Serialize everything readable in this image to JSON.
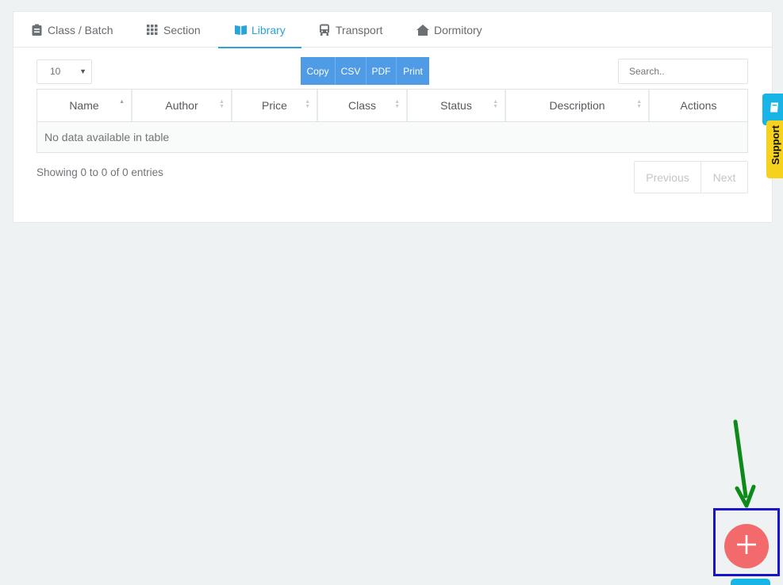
{
  "tabs": [
    {
      "label": "Class / Batch",
      "icon": "clipboard-icon",
      "active": false
    },
    {
      "label": "Section",
      "icon": "grid-icon",
      "active": false
    },
    {
      "label": "Library",
      "icon": "book-icon",
      "active": true
    },
    {
      "label": "Transport",
      "icon": "bus-icon",
      "active": false
    },
    {
      "label": "Dormitory",
      "icon": "home-icon",
      "active": false
    }
  ],
  "table_controls": {
    "page_length": "10",
    "export_buttons": [
      "Copy",
      "CSV",
      "PDF",
      "Print"
    ],
    "search_placeholder": "Search.."
  },
  "table": {
    "columns": [
      "Name",
      "Author",
      "Price",
      "Class",
      "Status",
      "Description",
      "Actions"
    ],
    "empty_message": "No data available in table",
    "info": "Showing 0 to 0 of 0 entries"
  },
  "pagination": {
    "previous": "Previous",
    "next": "Next"
  },
  "support_tab": {
    "label": "Support"
  },
  "fab": {
    "icon": "plus-icon"
  },
  "colors": {
    "accent": "#29a3d8",
    "export_buttons": "#4f9be6",
    "fab": "#f36a6c",
    "support_yellow": "#f6d21d",
    "support_blue": "#19b4e6",
    "annotation_box": "#1a14c8",
    "annotation_arrow": "#0c8a1a"
  }
}
